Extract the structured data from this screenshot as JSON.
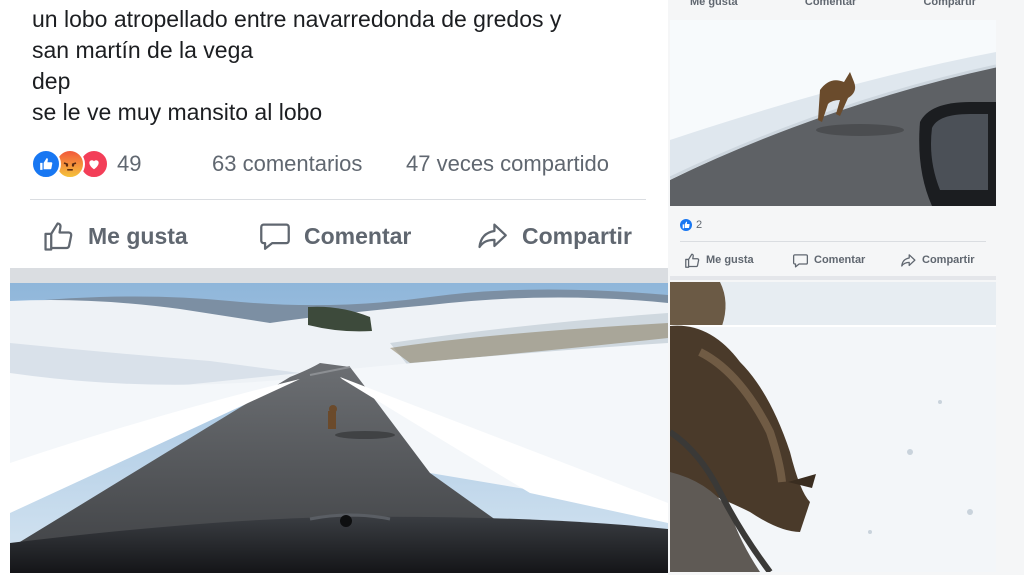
{
  "post": {
    "text_lines": [
      "un lobo atropellado entre navarredonda de gredos y",
      "san martín de la vega",
      "dep",
      "se le ve muy mansito al lobo"
    ],
    "reaction_count": "49",
    "comments": "63 comentarios",
    "shares": "47 veces compartido",
    "actions": {
      "like": "Me gusta",
      "comment": "Comentar",
      "share": "Compartir"
    }
  },
  "right_post": {
    "top_actions": {
      "like": "Me gusta",
      "comment": "Comentar",
      "share": "Compartir"
    },
    "reaction_count": "2",
    "actions": {
      "like": "Me gusta",
      "comment": "Comentar",
      "share": "Compartir"
    }
  },
  "icons": {
    "like": "thumbs-up-icon",
    "comment": "speech-bubble-icon",
    "share": "share-arrow-icon",
    "reaction_like": "like-reaction-icon",
    "reaction_angry": "angry-reaction-icon",
    "reaction_love": "love-reaction-icon"
  },
  "colors": {
    "facebook_blue": "#1877f2",
    "secondary_text": "#606770",
    "love_red": "#f33e58",
    "snow": "#f2f5f8",
    "road": "#55585c",
    "sky": "#a9c9e4"
  }
}
